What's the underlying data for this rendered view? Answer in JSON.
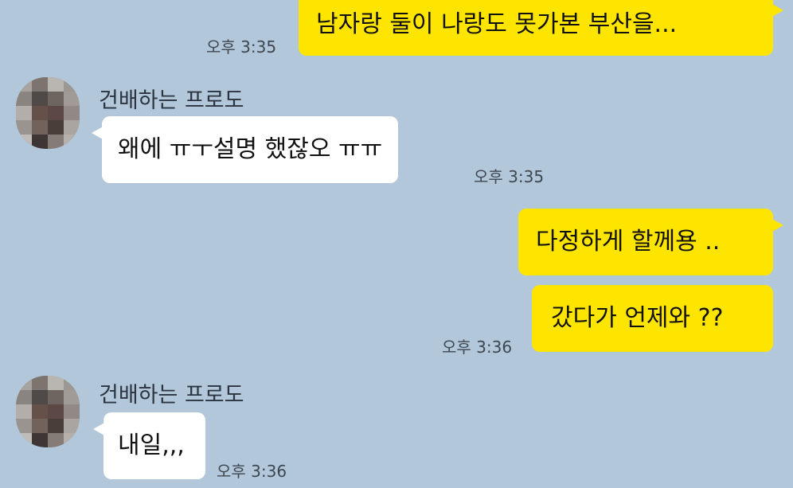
{
  "chat": {
    "messages": [
      {
        "direction": "out",
        "text": "남자랑 둘이 나랑도 못가본 부산을...",
        "time": "오후 3:35"
      },
      {
        "direction": "in",
        "sender": "건배하는 프로도",
        "text": "왜에 ㅠㅜ설명 했잖오 ㅠㅠ",
        "time": "오후 3:35"
      },
      {
        "direction": "out",
        "text": "다정하게 할께용 ..",
        "time": ""
      },
      {
        "direction": "out",
        "text": "갔다가 언제와 ??",
        "time": "오후 3:36"
      },
      {
        "direction": "in",
        "sender": "건배하는 프로도",
        "text": "내일,,,",
        "time": "오후 3:36"
      }
    ]
  },
  "colors": {
    "background": "#b2c7d9",
    "outgoing_bubble": "#fee500",
    "incoming_bubble": "#ffffff",
    "timestamp": "#3d4752"
  },
  "icons": {
    "avatar": "pixelated-profile-avatar"
  }
}
